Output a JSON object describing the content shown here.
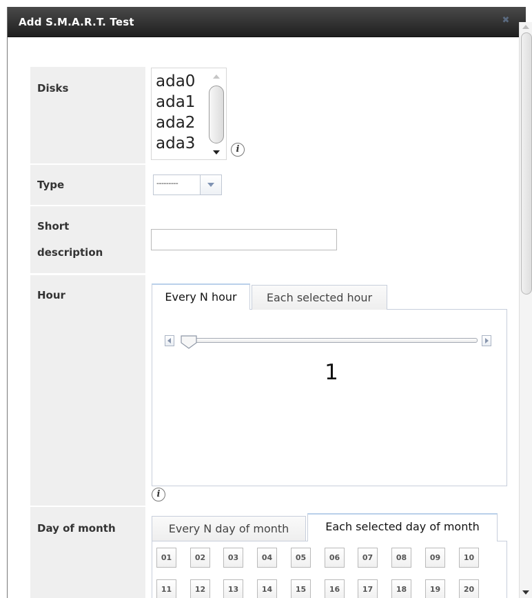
{
  "dialog": {
    "title": "Add S.M.A.R.T. Test",
    "close_icon": "close-x-icon"
  },
  "fields": {
    "disks": {
      "label": "Disks",
      "options": [
        "ada0",
        "ada1",
        "ada2",
        "ada3"
      ]
    },
    "type": {
      "label": "Type",
      "selected": "---------"
    },
    "short_description": {
      "label_line1": "Short",
      "label_line2": "description",
      "value": ""
    },
    "hour": {
      "label": "Hour",
      "tabs": [
        "Every N hour",
        "Each selected hour"
      ],
      "active_tab": "Every N hour",
      "slider_value": "1"
    },
    "day_of_month": {
      "label": "Day of month",
      "tabs": [
        "Every N day of month",
        "Each selected day of month"
      ],
      "active_tab": "Each selected day of month",
      "days_row1": [
        "01",
        "02",
        "03",
        "04",
        "05",
        "06",
        "07",
        "08",
        "09",
        "10"
      ],
      "days_row2": [
        "11",
        "12",
        "13",
        "14",
        "15",
        "16",
        "17",
        "18",
        "19",
        "20"
      ]
    }
  },
  "colors": {
    "titlebar": "#2e2e2e",
    "label_bg": "#efefef",
    "tab_border": "#c7cedb"
  }
}
